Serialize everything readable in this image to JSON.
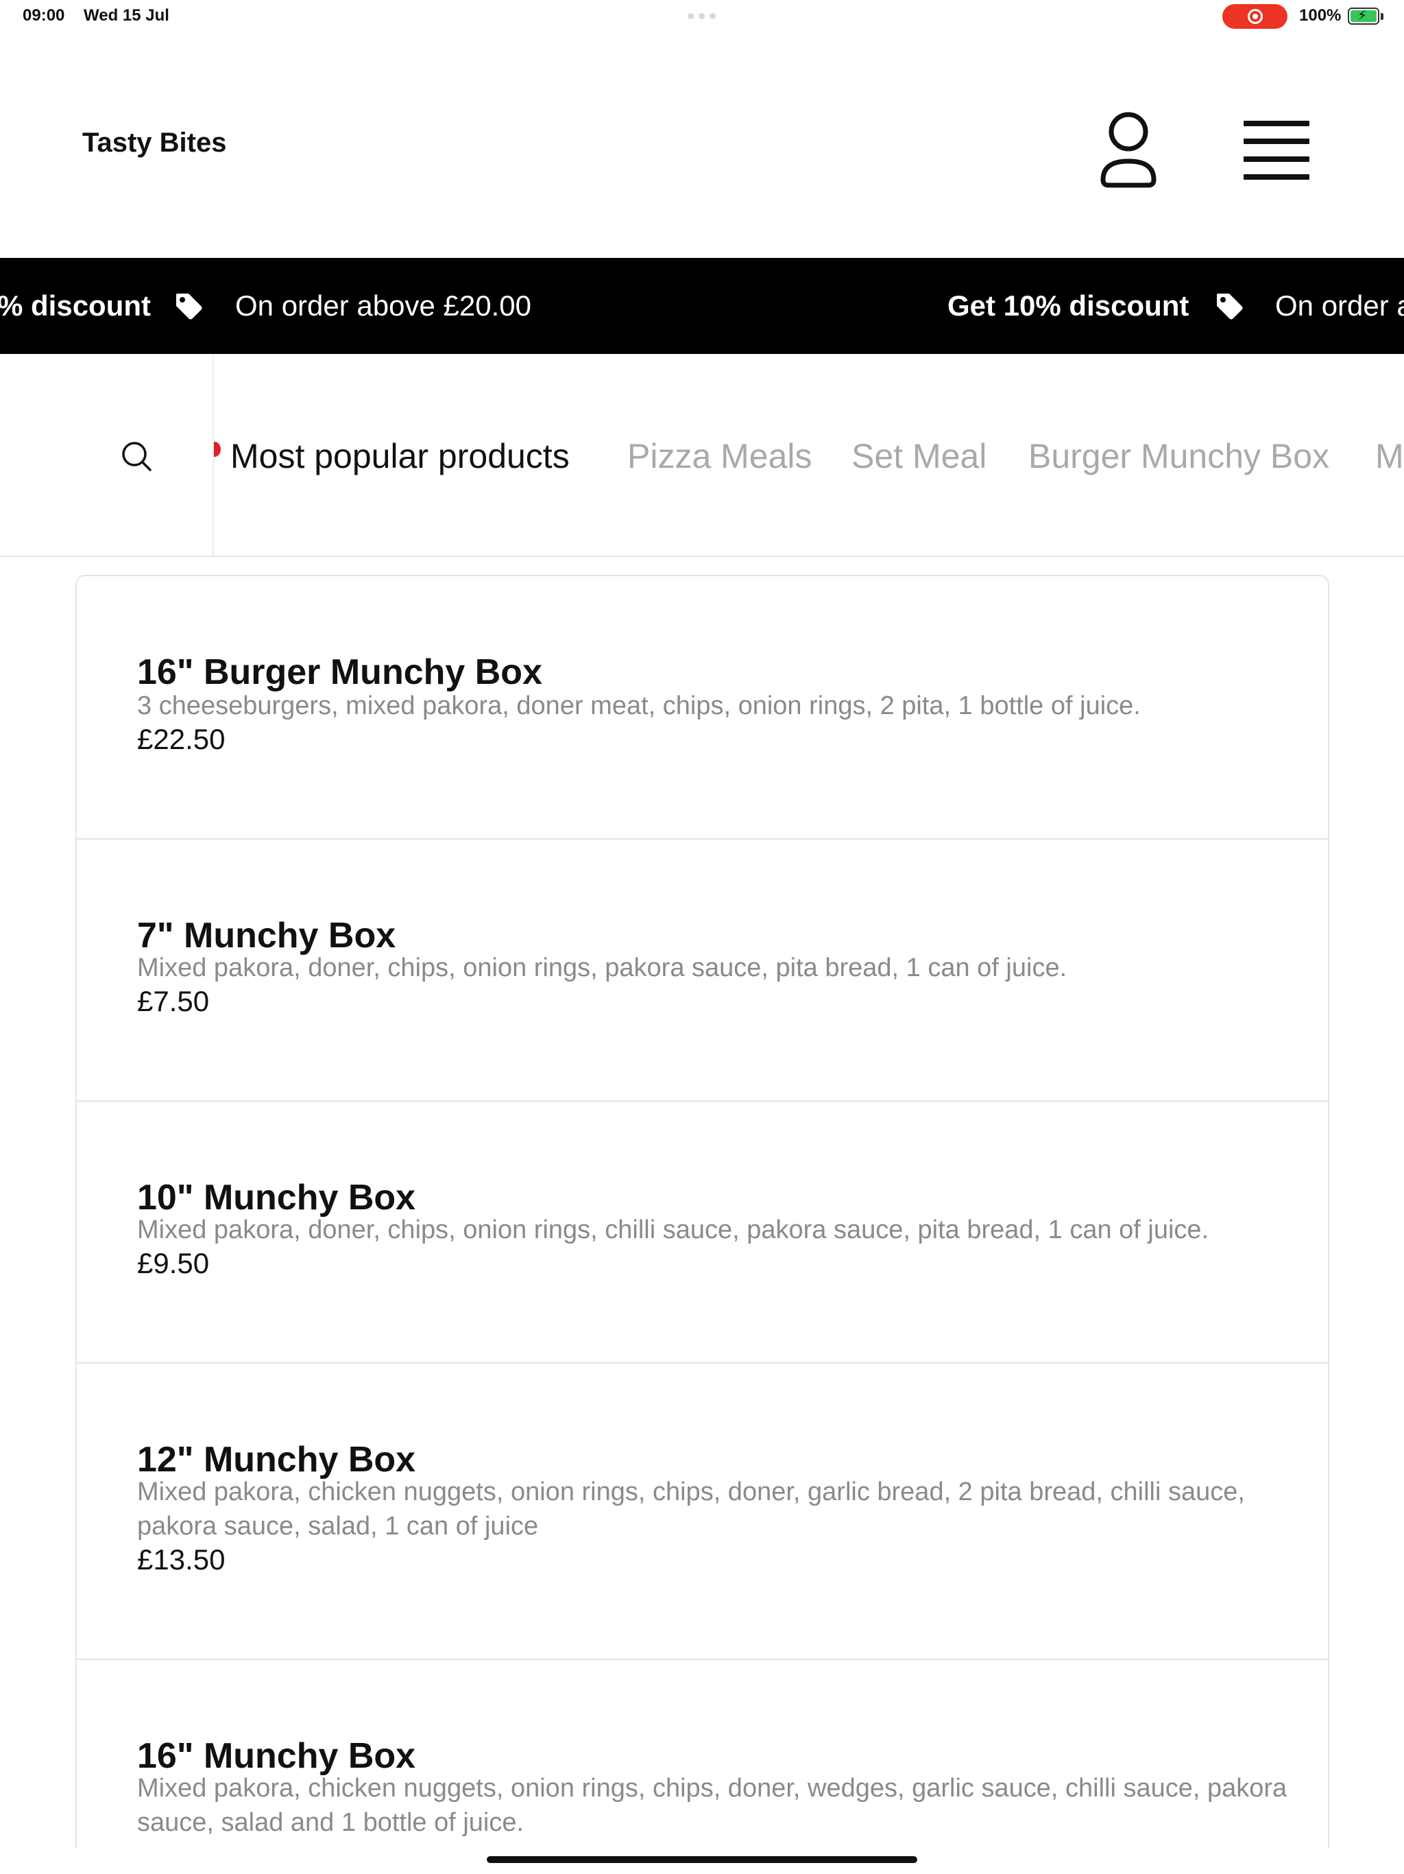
{
  "status_bar": {
    "time": "09:00",
    "date": "Wed 15 Jul",
    "battery": "100%"
  },
  "header": {
    "brand": "Tasty Bites"
  },
  "promo": {
    "items": [
      {
        "text": "% discount",
        "bold": true
      },
      {
        "text": "On order above £20.00",
        "bold": false
      },
      {
        "text": "Get 10% discount",
        "bold": true
      },
      {
        "text": "On order a",
        "bold": false
      }
    ]
  },
  "categories": {
    "tabs": [
      {
        "label": "Most popular products",
        "active": true
      },
      {
        "label": "Pizza Meals",
        "active": false
      },
      {
        "label": "Set Meal",
        "active": false
      },
      {
        "label": "Burger Munchy Box",
        "active": false
      },
      {
        "label": "M",
        "active": false
      }
    ]
  },
  "products": [
    {
      "name": "16\" Burger Munchy Box",
      "description": "3 cheeseburgers, mixed pakora, doner meat, chips, onion rings, 2 pita, 1 bottle of juice.",
      "price": "£22.50"
    },
    {
      "name": "7\" Munchy Box",
      "description": "Mixed pakora, doner, chips, onion rings, pakora sauce, pita bread, 1 can of juice.",
      "price": "£7.50"
    },
    {
      "name": "10\" Munchy Box",
      "description": "Mixed pakora, doner, chips, onion rings, chilli sauce, pakora sauce, pita bread, 1 can of juice.",
      "price": "£9.50"
    },
    {
      "name": "12\" Munchy Box",
      "description": "Mixed pakora, chicken nuggets, onion rings, chips, doner, garlic bread, 2 pita bread, chilli sauce, pakora sauce, salad, 1 can of juice",
      "price": "£13.50"
    },
    {
      "name": "16\" Munchy Box",
      "description": "Mixed pakora, chicken nuggets, onion rings, chips, doner, wedges, garlic sauce, chilli sauce, pakora sauce, salad and 1 bottle of juice.",
      "price": ""
    }
  ],
  "colors": {
    "accent_red": "#e0202a",
    "record_red": "#ec3324",
    "battery_green": "#35c759",
    "inactive_tab": "#a9a9a9",
    "description_gray": "#8a8a8a"
  }
}
